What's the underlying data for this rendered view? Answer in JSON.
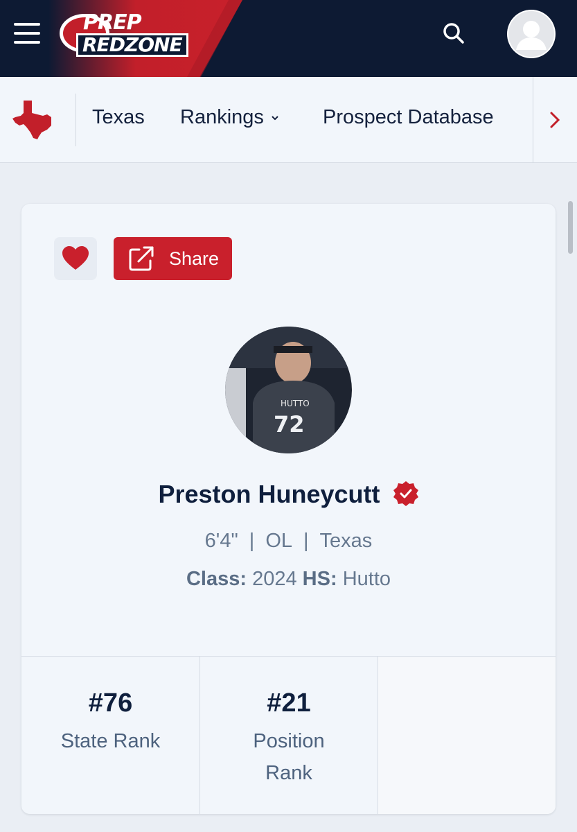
{
  "header": {
    "logo_line1": "PREP",
    "logo_line2": "REDZONE",
    "menu_icon": "hamburger-menu-icon",
    "search_icon": "search-icon",
    "avatar_icon": "user-avatar-icon",
    "colors": {
      "navy": "#0d1a33",
      "brand_red": "#c21f2a"
    }
  },
  "subnav": {
    "state_icon": "texas-state-icon",
    "items": [
      {
        "label": "Texas"
      },
      {
        "label": "Rankings",
        "has_dropdown": true
      },
      {
        "label": "Prospect Database"
      }
    ],
    "next_icon": "chevron-right-icon"
  },
  "profile": {
    "favorite_icon": "heart-icon",
    "share_label": "Share",
    "share_icon": "external-link-icon",
    "photo_alt": "player-photo",
    "name": "Preston Huneycutt",
    "verified_icon": "verified-badge-icon",
    "height": "6'4\"",
    "position": "OL",
    "state": "Texas",
    "separator": "|",
    "class_label": "Class:",
    "class_value": "2024",
    "hs_label": "HS:",
    "hs_value": "Hutto",
    "stats": [
      {
        "value": "#76",
        "label": "State Rank"
      },
      {
        "value": "#21",
        "label": "Position Rank"
      }
    ]
  }
}
